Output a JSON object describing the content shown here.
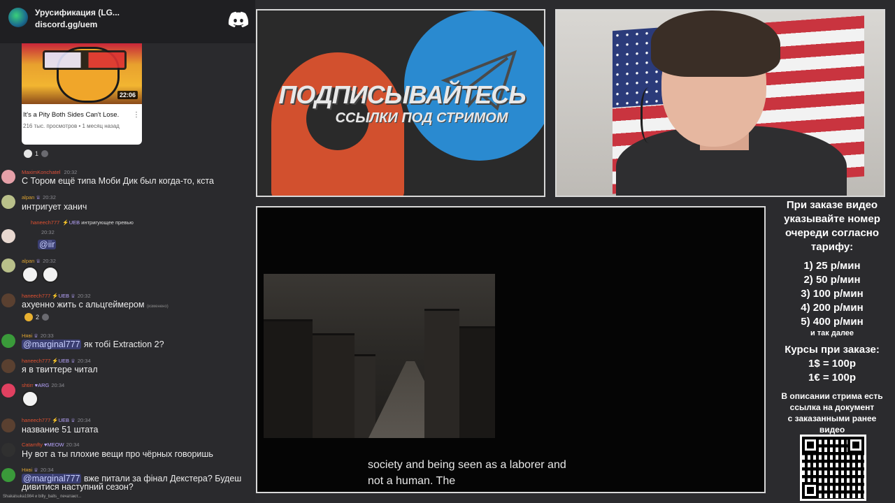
{
  "discord": {
    "server_name": "Урусификация (LG...",
    "invite": "discord.gg/uem"
  },
  "video_card": {
    "duration": "22:06",
    "title": "It's a Pity Both Sides Can't Lose.",
    "meta": "216 тыс. просмотров • 1 месяц назад",
    "reaction_count": "1"
  },
  "messages": [
    {
      "user": "MaximKonchatel",
      "badge": "",
      "time": "20:32",
      "text": "С Тором ещё типа Моби Дик был когда-то, кста",
      "user_color": "#e0503a",
      "avatar_color": "#e5a0a8"
    },
    {
      "user": "alpan",
      "badge": "♕",
      "time": "20:32",
      "text": "интригует ханич",
      "user_color": "#d9a030",
      "avatar_color": "#b9c08a"
    },
    {
      "user": "haneech777",
      "badge": "⚡UEB",
      "time": "",
      "text": "интригующее превью",
      "user_color": "#e05030",
      "avatar_color": "#e0d0c0",
      "reply": true
    },
    {
      "user": "",
      "badge": "",
      "time": "20:32",
      "text": "@iir",
      "user_color": "#aaaaaa",
      "avatar_color": "#e8d8d0",
      "mention": true
    },
    {
      "user": "alpan",
      "badge": "♕",
      "time": "20:32",
      "text": "",
      "user_color": "#d9a030",
      "avatar_color": "#b9c08a"
    },
    {
      "user": "haneech777",
      "badge": "⚡UEB ♕",
      "time": "20:32",
      "text": "ахуенно жить с альцгеймером",
      "edited": "(изменено)",
      "user_color": "#e05030",
      "avatar_color": "#5a4030",
      "reaction_count": "2"
    },
    {
      "user": "Няві",
      "badge": "♕",
      "time": "20:33",
      "text": "@marginal777 як тобі Extraction 2?",
      "user_color": "#d9a030",
      "avatar_color": "#3a9a3a",
      "mention_part": "@marginal777",
      "rest": " як тобі Extraction 2?"
    },
    {
      "user": "haneech777",
      "badge": "⚡UEB ♕",
      "time": "20:34",
      "text": "я в твиттере читал",
      "user_color": "#e05030",
      "avatar_color": "#5a4030"
    },
    {
      "user": "shtirr",
      "badge": "♥ARG",
      "time": "20:34",
      "text": "",
      "user_color": "#e05030",
      "avatar_color": "#e04060"
    },
    {
      "user": "haneech777",
      "badge": "⚡UEB ♕",
      "time": "20:34",
      "text": "название 51 штата",
      "user_color": "#e05030",
      "avatar_color": "#5a4030"
    },
    {
      "user": "Catamfty",
      "badge": "♥MEOW",
      "time": "20:34",
      "text": "Ну вот а ты плохие вещи про чёрных говоришь",
      "user_color": "#e05030",
      "avatar_color": "#303030"
    },
    {
      "user": "Няві",
      "badge": "♕",
      "time": "20:34",
      "text": "@marginal777 вже питали за фінал Декстера? Будеш",
      "text2": "дивитися наступний сезон?",
      "user_color": "#d9a030",
      "avatar_color": "#3a9a3a",
      "mention_part": "@marginal777",
      "rest": " вже питали за фінал Декстера? Будеш"
    }
  ],
  "typing": "Shakalsuka1984 и billy_balls_ печатают...",
  "promo": {
    "line1": "ПОДПИСЫВАЙТЕСЬ",
    "line2": "ССЫЛКИ ПОД СТРИМОМ"
  },
  "player": {
    "subtitle_line1": "society and being seen as a laborer and",
    "subtitle_line2": "not a human. The"
  },
  "info": {
    "heading": [
      "При заказе видео",
      "указывайте номер",
      "очереди согласно",
      "тарифу:"
    ],
    "tariffs": [
      "1) 25 р/мин",
      "2) 50 р/мин",
      "3) 100 р/мин",
      "4) 200 р/мин",
      "5) 400 р/мин"
    ],
    "and_so_on": "и так далее",
    "rates_heading": "Курсы при заказе:",
    "rates": [
      "1$ = 100р",
      "1€ = 100р"
    ],
    "description": [
      "В описании стрима есть",
      "ссылка на документ",
      "с заказанными ранее",
      "видео"
    ]
  }
}
